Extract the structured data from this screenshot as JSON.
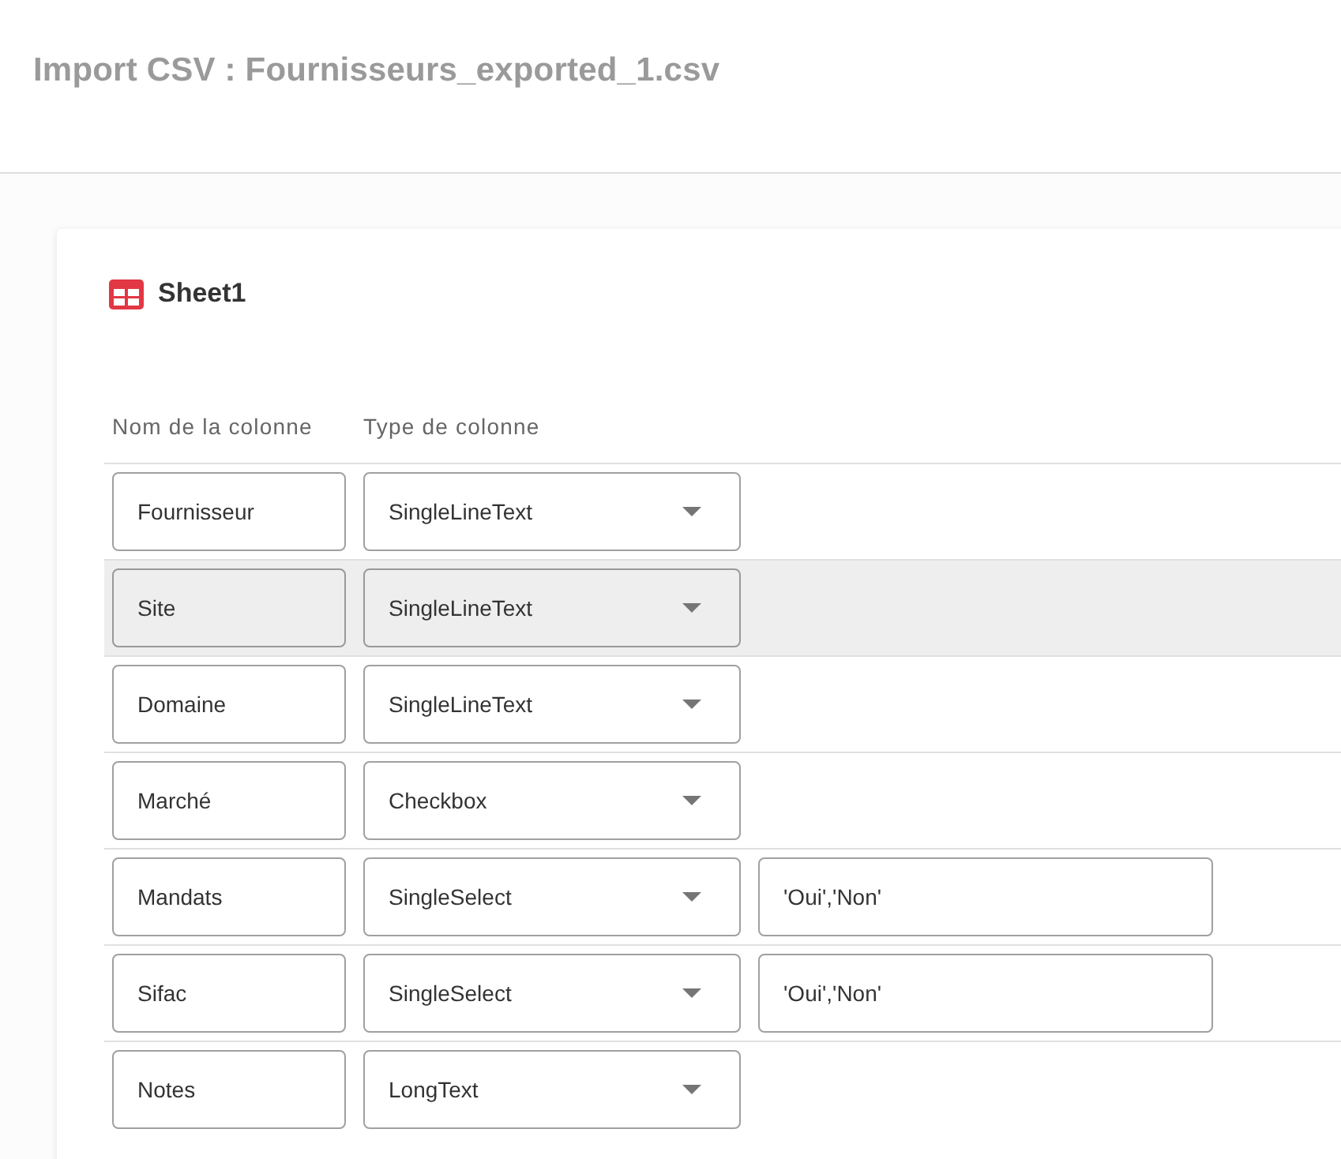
{
  "page": {
    "title": "Import CSV : Fournisseurs_exported_1.csv"
  },
  "sheet": {
    "name": "Sheet1"
  },
  "table": {
    "columns": [
      "Nom de la colonne",
      "Type de colonne"
    ],
    "rows": [
      {
        "name": "Fournisseur",
        "type": "SingleLineText",
        "highlighted": false
      },
      {
        "name": "Site",
        "type": "SingleLineText",
        "highlighted": true
      },
      {
        "name": "Domaine",
        "type": "SingleLineText",
        "highlighted": false
      },
      {
        "name": "Marché",
        "type": "Checkbox",
        "highlighted": false
      },
      {
        "name": "Mandats",
        "type": "SingleSelect",
        "options": "'Oui','Non'",
        "highlighted": false
      },
      {
        "name": "Sifac",
        "type": "SingleSelect",
        "options": "'Oui','Non'",
        "highlighted": false
      },
      {
        "name": "Notes",
        "type": "LongText",
        "highlighted": false
      }
    ]
  }
}
